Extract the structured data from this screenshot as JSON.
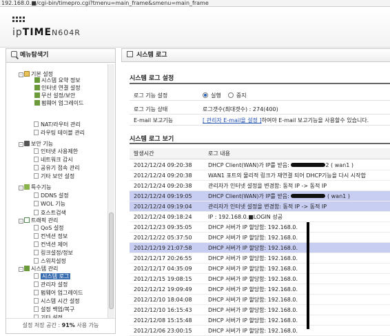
{
  "browser": {
    "url": "192.168.0.■/cgi-bin/timepro.cgi?tmenu=main_frame&smenu=main_frame"
  },
  "brand": {
    "logo_prefix": "ip",
    "logo_bold": "TIME",
    "model": "N604R"
  },
  "sidebar": {
    "title": "메뉴탐색기",
    "footer_label": "설정 저장 공간 : ",
    "footer_value": "91%",
    "footer_suffix": " 사용 가능",
    "tree": [
      {
        "label": "기본 설정",
        "expand": "-",
        "icon": "folder"
      },
      {
        "label": "시스템 요약 정보",
        "icon": "chart"
      },
      {
        "label": "인터넷 연결 설정",
        "icon": "chart"
      },
      {
        "label": "무선 설정/보안",
        "icon": "chart"
      },
      {
        "label": "펌웨어 업그레이드",
        "icon": "chart"
      },
      {
        "label": "NAT/라우터 관리",
        "icon": "leaf"
      },
      {
        "label": "라우팅 테이블 관리",
        "icon": "leaf"
      },
      {
        "label": "보안 기능",
        "expand": "-",
        "icon": "lock"
      },
      {
        "label": "인터넷 사용제한",
        "icon": "leaf"
      },
      {
        "label": "네트워크 감시",
        "icon": "leaf"
      },
      {
        "label": "공유기 접속 관리",
        "icon": "leaf"
      },
      {
        "label": "기타 보안 설정",
        "icon": "leaf"
      },
      {
        "label": "특수기능",
        "expand": "-",
        "icon": "star"
      },
      {
        "label": "DDNS 설정",
        "icon": "leaf"
      },
      {
        "label": "WOL 기능",
        "icon": "leaf"
      },
      {
        "label": "호스트검색",
        "icon": "leaf"
      },
      {
        "label": "트래픽 관리",
        "expand": "-",
        "icon": "mail"
      },
      {
        "label": "QoS 설정",
        "icon": "leaf"
      },
      {
        "label": "컨넥션 정보",
        "icon": "leaf"
      },
      {
        "label": "컨넥션 제어",
        "icon": "leaf"
      },
      {
        "label": "링크설정/정보",
        "icon": "leaf"
      },
      {
        "label": "스위치설정",
        "icon": "leaf"
      },
      {
        "label": "시스템 관리",
        "expand": "-",
        "icon": "chart"
      },
      {
        "label": "시스템 로그",
        "icon": "leaf",
        "selected": true
      },
      {
        "label": "관리자 설정",
        "icon": "leaf"
      },
      {
        "label": "펌웨어 업그레이드",
        "icon": "leaf"
      },
      {
        "label": "시스템 시간 설정",
        "icon": "leaf"
      },
      {
        "label": "설정 백업/복구",
        "icon": "leaf"
      },
      {
        "label": "기타 설정",
        "icon": "leaf"
      }
    ]
  },
  "main": {
    "title": "시스템 로그",
    "settings_title": "시스템 로그 설정",
    "settings": {
      "log_func_label": "로그 기능 설정",
      "radio_on": "실행",
      "radio_off": "중지",
      "log_state_label": "로그 기능 상태",
      "log_state_value": "로그갯수(최대갯수) : 274(400)",
      "email_label": "E-mail 보고기능",
      "email_link": "[ 관리자 E-mail을 설정 ]",
      "email_rest": "하여야 E-mail 보고기능을 사용할수 있습니다."
    },
    "view_title": "시스템 로그 보기",
    "col_time": "발생시간",
    "col_msg": "로그 내용",
    "logs": [
      {
        "time": "2012/12/24 09:20:38",
        "pre": "DHCP Client(WAN)가 IP를 받음: ",
        "redact": true,
        "post": "2 ( wan1 )"
      },
      {
        "time": "2012/12/24 09:20:38",
        "pre": "WAN1 포트의 물리적 링크가 재연결 되어 DHCP기능을 다시 시작합"
      },
      {
        "time": "2012/12/24 09:20:38",
        "pre": "관리자가 인터넷 설정을 변경함: 동적 IP -> 동적 IP"
      },
      {
        "time": "2012/12/24 09:19:05",
        "pre": "DHCP Client(WAN)가 IP를 받음: ",
        "redact": true,
        "post": " ( wan1 )",
        "hl": true
      },
      {
        "time": "2012/12/24 09:19:04",
        "pre": "관리자가 인터넷 설정을 변경함: 동적 IP -> 동적 IP",
        "hl": true
      },
      {
        "time": "2012/12/24 09:18:24",
        "pre": "IP : 192.168.0.■LOGIN 성공"
      },
      {
        "time": "2012/12/23 09:35:05",
        "pre": "DHCP 서버가 IP 할당함: 192.168.0."
      },
      {
        "time": "2012/12/22 05:37:50",
        "pre": "DHCP 서버가 IP 할당함: 192.168.0."
      },
      {
        "time": "2012/12/19 21:07:58",
        "pre": "DHCP 서버가 IP 할당함: 192.168.0.",
        "hl": true
      },
      {
        "time": "2012/12/17 20:26:55",
        "pre": "DHCP 서버가 IP 할당함: 192.168.0."
      },
      {
        "time": "2012/12/17 04:35:09",
        "pre": "DHCP 서버가 IP 할당함: 192.168.0."
      },
      {
        "time": "2012/12/15 19:08:15",
        "pre": "DHCP 서버가 IP 할당함: 192.168.0."
      },
      {
        "time": "2012/12/12 19:09:49",
        "pre": "DHCP 서버가 IP 할당함: 192.168.0."
      },
      {
        "time": "2012/12/10 18:04:08",
        "pre": "DHCP 서버가 IP 할당함: 192.168.0."
      },
      {
        "time": "2012/12/10 16:15:43",
        "pre": "DHCP 서버가 IP 할당함: 192.168.0."
      },
      {
        "time": "2012/12/08 15:15:48",
        "pre": "DHCP 서버가 IP 할당함: 192.168.0."
      },
      {
        "time": "2012/12/06 23:00:15",
        "pre": "DHCP 서버가 IP 할당함: 192.168.0."
      }
    ]
  }
}
